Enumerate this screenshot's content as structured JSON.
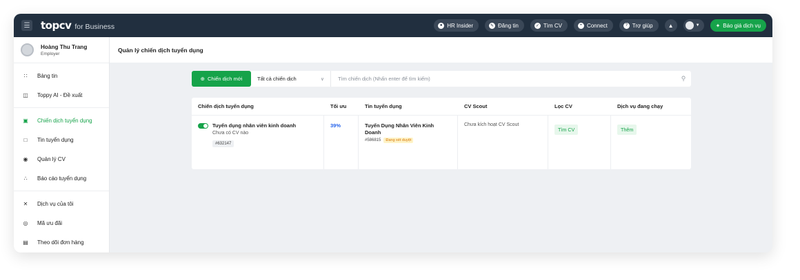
{
  "topbar": {
    "brand_logo": "topcv",
    "brand_sub": "for Business",
    "nav": [
      {
        "label": "HR Insider",
        "icon": "circle-dot-icon"
      },
      {
        "label": "Đăng tin",
        "icon": "edit-icon"
      },
      {
        "label": "Tìm CV",
        "icon": "search-icon"
      },
      {
        "label": "Connect",
        "icon": "chat-icon"
      },
      {
        "label": "Trợ giúp",
        "icon": "help-icon"
      }
    ],
    "cta_label": "Báo giá dịch vụ"
  },
  "sidebar": {
    "user_name": "Hoàng Thu Trang",
    "user_role": "Employer",
    "groups": [
      [
        {
          "label": "Bảng tin",
          "icon": "grid-icon"
        },
        {
          "label": "Toppy AI - Đề xuất",
          "icon": "robot-icon"
        }
      ],
      [
        {
          "label": "Chiến dịch tuyển dụng",
          "icon": "briefcase-icon",
          "active": true
        },
        {
          "label": "Tin tuyển dụng",
          "icon": "document-icon"
        },
        {
          "label": "Quản lý CV",
          "icon": "user-circle-icon"
        },
        {
          "label": "Báo cáo tuyển dụng",
          "icon": "chart-icon"
        }
      ],
      [
        {
          "label": "Dịch vụ của tôi",
          "icon": "tools-icon"
        },
        {
          "label": "Mã ưu đãi",
          "icon": "gift-icon"
        },
        {
          "label": "Theo dõi đơn hàng",
          "icon": "receipt-icon"
        }
      ]
    ]
  },
  "page": {
    "title": "Quản lý chiến dịch tuyển dụng"
  },
  "toolbar": {
    "new_label": "Chiến dịch mới",
    "filter_value": "Tất cả chiến dịch",
    "search_placeholder": "Tìm chiến dịch (Nhấn enter để tìm kiếm)"
  },
  "table": {
    "headers": [
      "Chiến dịch tuyển dụng",
      "Tối ưu",
      "Tin tuyển dụng",
      "CV Scout",
      "Lọc CV",
      "Dịch vụ đang chạy"
    ],
    "rows": [
      {
        "campaign_name": "Tuyển dụng nhân viên kinh doanh",
        "campaign_sub": "Chưa có CV nào",
        "campaign_id": "#632147",
        "optimize": "39%",
        "job_title": "Tuyển Dụng Nhân Viên Kinh Doanh",
        "job_id": "#586815",
        "job_status": "Đang xét duyệt",
        "cv_scout": "Chưa kích hoạt CV Scout",
        "filter_cv": "Tìm CV",
        "service": "Thêm"
      }
    ]
  }
}
